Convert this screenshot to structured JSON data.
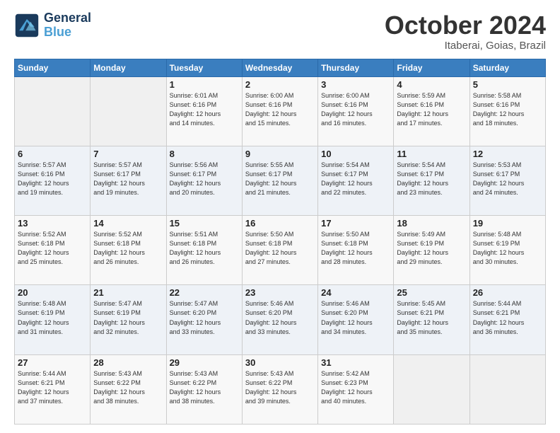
{
  "header": {
    "logo_line1": "General",
    "logo_line2": "Blue",
    "month": "October 2024",
    "location": "Itaberai, Goias, Brazil"
  },
  "weekdays": [
    "Sunday",
    "Monday",
    "Tuesday",
    "Wednesday",
    "Thursday",
    "Friday",
    "Saturday"
  ],
  "weeks": [
    [
      {
        "day": "",
        "info": ""
      },
      {
        "day": "",
        "info": ""
      },
      {
        "day": "1",
        "info": "Sunrise: 6:01 AM\nSunset: 6:16 PM\nDaylight: 12 hours\nand 14 minutes."
      },
      {
        "day": "2",
        "info": "Sunrise: 6:00 AM\nSunset: 6:16 PM\nDaylight: 12 hours\nand 15 minutes."
      },
      {
        "day": "3",
        "info": "Sunrise: 6:00 AM\nSunset: 6:16 PM\nDaylight: 12 hours\nand 16 minutes."
      },
      {
        "day": "4",
        "info": "Sunrise: 5:59 AM\nSunset: 6:16 PM\nDaylight: 12 hours\nand 17 minutes."
      },
      {
        "day": "5",
        "info": "Sunrise: 5:58 AM\nSunset: 6:16 PM\nDaylight: 12 hours\nand 18 minutes."
      }
    ],
    [
      {
        "day": "6",
        "info": "Sunrise: 5:57 AM\nSunset: 6:16 PM\nDaylight: 12 hours\nand 19 minutes."
      },
      {
        "day": "7",
        "info": "Sunrise: 5:57 AM\nSunset: 6:17 PM\nDaylight: 12 hours\nand 19 minutes."
      },
      {
        "day": "8",
        "info": "Sunrise: 5:56 AM\nSunset: 6:17 PM\nDaylight: 12 hours\nand 20 minutes."
      },
      {
        "day": "9",
        "info": "Sunrise: 5:55 AM\nSunset: 6:17 PM\nDaylight: 12 hours\nand 21 minutes."
      },
      {
        "day": "10",
        "info": "Sunrise: 5:54 AM\nSunset: 6:17 PM\nDaylight: 12 hours\nand 22 minutes."
      },
      {
        "day": "11",
        "info": "Sunrise: 5:54 AM\nSunset: 6:17 PM\nDaylight: 12 hours\nand 23 minutes."
      },
      {
        "day": "12",
        "info": "Sunrise: 5:53 AM\nSunset: 6:17 PM\nDaylight: 12 hours\nand 24 minutes."
      }
    ],
    [
      {
        "day": "13",
        "info": "Sunrise: 5:52 AM\nSunset: 6:18 PM\nDaylight: 12 hours\nand 25 minutes."
      },
      {
        "day": "14",
        "info": "Sunrise: 5:52 AM\nSunset: 6:18 PM\nDaylight: 12 hours\nand 26 minutes."
      },
      {
        "day": "15",
        "info": "Sunrise: 5:51 AM\nSunset: 6:18 PM\nDaylight: 12 hours\nand 26 minutes."
      },
      {
        "day": "16",
        "info": "Sunrise: 5:50 AM\nSunset: 6:18 PM\nDaylight: 12 hours\nand 27 minutes."
      },
      {
        "day": "17",
        "info": "Sunrise: 5:50 AM\nSunset: 6:18 PM\nDaylight: 12 hours\nand 28 minutes."
      },
      {
        "day": "18",
        "info": "Sunrise: 5:49 AM\nSunset: 6:19 PM\nDaylight: 12 hours\nand 29 minutes."
      },
      {
        "day": "19",
        "info": "Sunrise: 5:48 AM\nSunset: 6:19 PM\nDaylight: 12 hours\nand 30 minutes."
      }
    ],
    [
      {
        "day": "20",
        "info": "Sunrise: 5:48 AM\nSunset: 6:19 PM\nDaylight: 12 hours\nand 31 minutes."
      },
      {
        "day": "21",
        "info": "Sunrise: 5:47 AM\nSunset: 6:19 PM\nDaylight: 12 hours\nand 32 minutes."
      },
      {
        "day": "22",
        "info": "Sunrise: 5:47 AM\nSunset: 6:20 PM\nDaylight: 12 hours\nand 33 minutes."
      },
      {
        "day": "23",
        "info": "Sunrise: 5:46 AM\nSunset: 6:20 PM\nDaylight: 12 hours\nand 33 minutes."
      },
      {
        "day": "24",
        "info": "Sunrise: 5:46 AM\nSunset: 6:20 PM\nDaylight: 12 hours\nand 34 minutes."
      },
      {
        "day": "25",
        "info": "Sunrise: 5:45 AM\nSunset: 6:21 PM\nDaylight: 12 hours\nand 35 minutes."
      },
      {
        "day": "26",
        "info": "Sunrise: 5:44 AM\nSunset: 6:21 PM\nDaylight: 12 hours\nand 36 minutes."
      }
    ],
    [
      {
        "day": "27",
        "info": "Sunrise: 5:44 AM\nSunset: 6:21 PM\nDaylight: 12 hours\nand 37 minutes."
      },
      {
        "day": "28",
        "info": "Sunrise: 5:43 AM\nSunset: 6:22 PM\nDaylight: 12 hours\nand 38 minutes."
      },
      {
        "day": "29",
        "info": "Sunrise: 5:43 AM\nSunset: 6:22 PM\nDaylight: 12 hours\nand 38 minutes."
      },
      {
        "day": "30",
        "info": "Sunrise: 5:43 AM\nSunset: 6:22 PM\nDaylight: 12 hours\nand 39 minutes."
      },
      {
        "day": "31",
        "info": "Sunrise: 5:42 AM\nSunset: 6:23 PM\nDaylight: 12 hours\nand 40 minutes."
      },
      {
        "day": "",
        "info": ""
      },
      {
        "day": "",
        "info": ""
      }
    ]
  ]
}
